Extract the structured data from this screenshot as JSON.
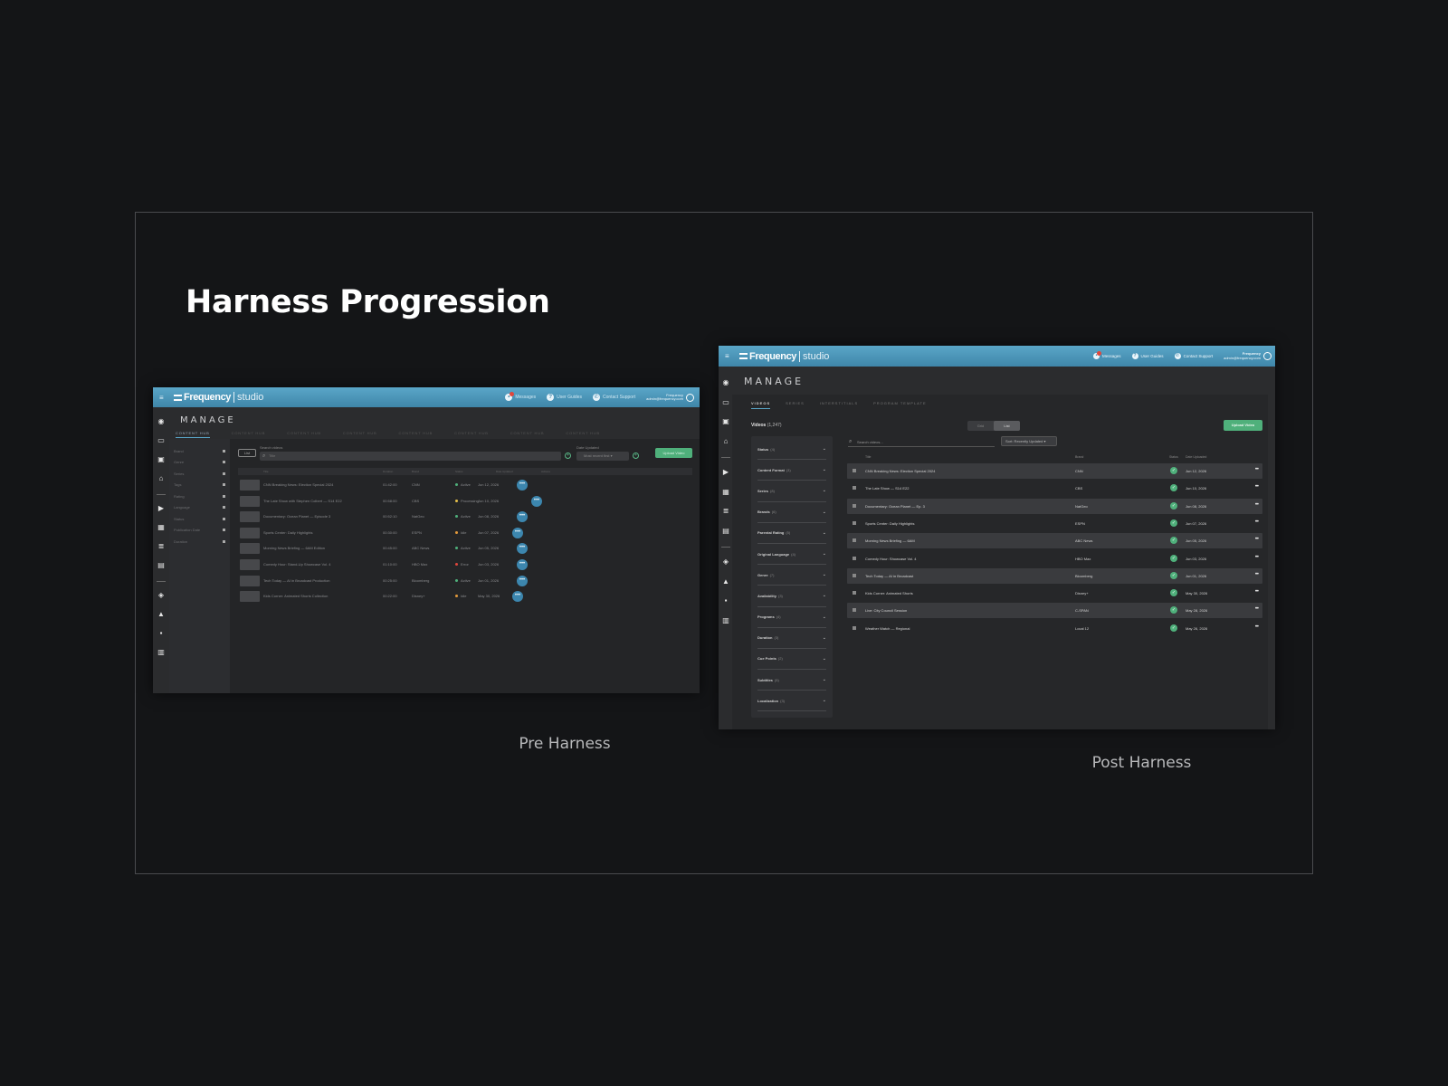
{
  "slide": {
    "title": "Harness Progression",
    "caption_pre": "Pre Harness",
    "caption_post": "Post Harness"
  },
  "app": {
    "menu_icon": "≡",
    "logo_main": "Frequency",
    "logo_sub": "studio",
    "page_title": "MANAGE",
    "accent": "#4a96bb",
    "success": "#4fb07b",
    "rail_icons": [
      "target-icon",
      "monitor-icon",
      "inbox-icon",
      "broadcast-icon",
      "play-screen-icon",
      "grid-icon",
      "stack-icon",
      "calendar-icon",
      "shield-icon",
      "chart-icon",
      "person-card-icon",
      "table-icon"
    ]
  },
  "pre": {
    "topnav": {
      "messages": "Messages",
      "user_guides": "User Guides",
      "contact_support": "Contact Support"
    },
    "tabs": [
      "CONTENT HUB",
      "CONTENT HUB",
      "CONTENT HUB",
      "CONTENT HUB",
      "CONTENT HUB",
      "CONTENT HUB",
      "CONTENT HUB",
      "CONTENT HUB"
    ],
    "filters": [
      "Brand",
      "Genre",
      "Series",
      "Tags",
      "Rating",
      "Language",
      "Status",
      "Publication Date",
      "Duration"
    ],
    "list_button": "List",
    "search_label": "Search videos",
    "search_placeholder": "Title",
    "date_label": "Date Updated",
    "date_value": "Most recent first",
    "upload": "Upload Video",
    "headers": {
      "title": "Title",
      "duration": "Duration",
      "brand": "Brand",
      "status": "Status",
      "date": "Date Updated",
      "actions": "Actions"
    },
    "rows": [
      {
        "title": "CNN Breaking News: Election Special 2024",
        "duration": "01:42:00",
        "brand": "CNN",
        "status": "Active",
        "status_color": "#4fb07b",
        "date": "Jun 12, 2026"
      },
      {
        "title": "The Late Show with Stephen Colbert — S14 E22",
        "duration": "00:58:00",
        "brand": "CBS",
        "status": "Processing",
        "status_color": "#e6c04a",
        "date": "Jun 10, 2026"
      },
      {
        "title": "Documentary: Ocean Planet — Episode 3",
        "duration": "00:52:10",
        "brand": "NatGeo",
        "status": "Active",
        "status_color": "#4fb07b",
        "date": "Jun 08, 2026"
      },
      {
        "title": "Sports Center: Daily Highlights",
        "duration": "00:30:00",
        "brand": "ESPN",
        "status": "Idle",
        "status_color": "#e39a3b",
        "date": "Jun 07, 2026"
      },
      {
        "title": "Morning News Briefing — 6AM Edition",
        "duration": "00:45:00",
        "brand": "ABC News",
        "status": "Active",
        "status_color": "#4fb07b",
        "date": "Jun 05, 2026"
      },
      {
        "title": "Comedy Hour: Stand-Up Showcase Vol. 4",
        "duration": "01:10:00",
        "brand": "HBO Max",
        "status": "Error",
        "status_color": "#e0473c",
        "date": "Jun 03, 2026"
      },
      {
        "title": "Tech Today — AI in Broadcast Production",
        "duration": "00:25:00",
        "brand": "Bloomberg",
        "status": "Active",
        "status_color": "#4fb07b",
        "date": "Jun 01, 2026"
      },
      {
        "title": "Kids Corner: Animated Shorts Collection",
        "duration": "00:22:00",
        "brand": "Disney+",
        "status": "Idle",
        "status_color": "#e39a3b",
        "date": "May 30, 2026"
      }
    ]
  },
  "post": {
    "topnav": {
      "messages": "Messages",
      "user_guides": "User Guides",
      "contact_support": "Contact Support"
    },
    "user_name": "Frequency",
    "user_email": "admin@frequency.com",
    "tabs": [
      "VIDEOS",
      "SERIES",
      "INTERSTITIALS",
      "PROGRAM TEMPLATE"
    ],
    "count_label": "Videos",
    "count_value": "(1,247)",
    "toggle": [
      "Grid",
      "List"
    ],
    "upload": "Upload Video",
    "search_placeholder": "Search videos...",
    "sort": "Sort: Recently Updated",
    "filters": [
      {
        "label": "Status",
        "count": "(4)"
      },
      {
        "label": "Content Format",
        "count": "(3)"
      },
      {
        "label": "Series",
        "count": "(8)"
      },
      {
        "label": "Brands",
        "count": "(6)"
      },
      {
        "label": "Parental Rating",
        "count": "(5)"
      },
      {
        "label": "Original Language",
        "count": "(4)"
      },
      {
        "label": "Genre",
        "count": "(7)"
      },
      {
        "label": "Availability",
        "count": "(3)"
      },
      {
        "label": "Programs",
        "count": "(4)"
      },
      {
        "label": "Duration",
        "count": "(3)"
      },
      {
        "label": "Cue Points",
        "count": "(2)"
      },
      {
        "label": "Subtitles",
        "count": "(5)"
      },
      {
        "label": "Localization",
        "count": "(3)"
      }
    ],
    "headers": {
      "title": "Title",
      "brand": "Brand",
      "status": "Status",
      "date": "Date Uploaded"
    },
    "rows": [
      {
        "title": "CNN Breaking News: Election Special 2024",
        "brand": "CNN",
        "date": "Jun 12, 2026"
      },
      {
        "title": "The Late Show — S14 E22",
        "brand": "CBS",
        "date": "Jun 10, 2026"
      },
      {
        "title": "Documentary: Ocean Planet — Ep. 3",
        "brand": "NatGeo",
        "date": "Jun 08, 2026"
      },
      {
        "title": "Sports Center: Daily Highlights",
        "brand": "ESPN",
        "date": "Jun 07, 2026"
      },
      {
        "title": "Morning News Briefing — 6AM",
        "brand": "ABC News",
        "date": "Jun 05, 2026"
      },
      {
        "title": "Comedy Hour: Showcase Vol. 4",
        "brand": "HBO Max",
        "date": "Jun 03, 2026"
      },
      {
        "title": "Tech Today — AI in Broadcast",
        "brand": "Bloomberg",
        "date": "Jun 01, 2026"
      },
      {
        "title": "Kids Corner: Animated Shorts",
        "brand": "Disney+",
        "date": "May 30, 2026"
      },
      {
        "title": "Live: City Council Session",
        "brand": "C-SPAN",
        "date": "May 28, 2026"
      },
      {
        "title": "Weather Watch — Regional",
        "brand": "Local 12",
        "date": "May 26, 2026"
      }
    ]
  }
}
